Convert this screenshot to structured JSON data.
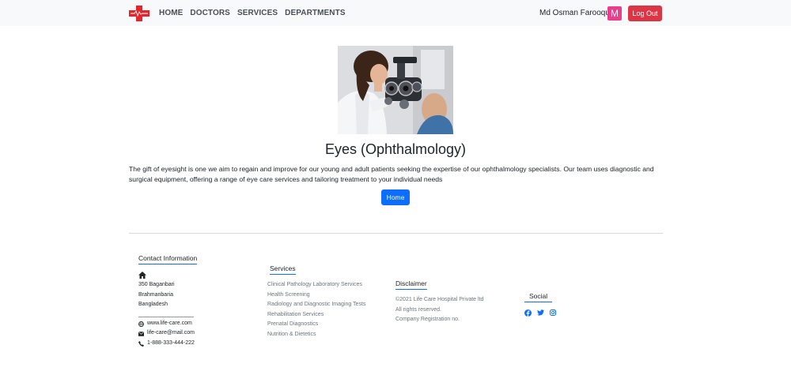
{
  "nav": {
    "links": [
      "HOME",
      "DOCTORS",
      "SERVICES",
      "DEPARTMENTS"
    ],
    "user_name": "Md Osman Farooque",
    "avatar_letter": "M",
    "logout_label": "Log Out"
  },
  "main": {
    "title": "Eyes (Ophthalmology)",
    "description": "The gift of eyesight is one we aim to regain and improve for our young and adult patients seeking the expertise of our ophthalmology specialists. Our team uses diagnostic and surgical equipment, offering a range of eye care services and tailoring treatment to your individual needs",
    "home_label": "Home"
  },
  "footer": {
    "contact": {
      "heading": "Contact Information",
      "address": [
        "350 Baganbari",
        "Brahmanbaria",
        "Bangladesh"
      ],
      "website": "www.life-care.com",
      "email": "life-care@mail.com",
      "phone": "1-888-333-444-222"
    },
    "services": {
      "heading": "Services",
      "items": [
        "Clinical Pathology Laboratory Services",
        "Health Screening",
        "Radiology and Diagnostic Imaging Tests",
        "Rehabilitation Services",
        "Prenatal Diagnostics",
        "Nutrition & Dietetics"
      ]
    },
    "disclaimer": {
      "heading": "Disclaimer",
      "lines": [
        "©2021 Life Care Hospital Private ltd",
        "All rights reserved.",
        "Company Registration no."
      ]
    },
    "social": {
      "heading": "Social",
      "icons": [
        "facebook-icon",
        "twitter-icon",
        "instagram-icon"
      ]
    }
  },
  "colors": {
    "primary": "#0d6efd",
    "danger": "#dc3545",
    "avatar": "#e83e8c",
    "logo_red": "#e3262e"
  }
}
